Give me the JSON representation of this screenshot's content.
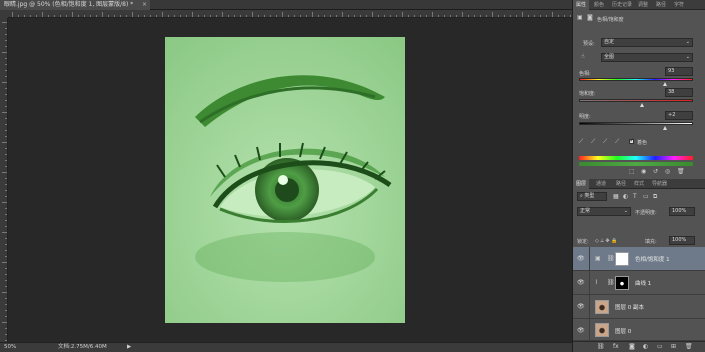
{
  "document": {
    "tab_title": "眼睛.jpg @ 50% (色相/饱和度 1, 图层蒙版/8) *",
    "close_glyph": "×"
  },
  "status": {
    "zoom": "50%",
    "doc_size": "文档:2.75M/6.40M",
    "arrow": "▶"
  },
  "properties_panel": {
    "tabs": [
      "属性",
      "颜色",
      "历史记录",
      "调整",
      "路径",
      "字符"
    ],
    "header": "色相/饱和度",
    "preset_label": "预设:",
    "preset_value": "自定",
    "channel_value": "全图",
    "hue_label": "色相:",
    "hue_value": "93",
    "saturation_label": "饱和度:",
    "saturation_value": "38",
    "lightness_label": "明度:",
    "lightness_value": "+2",
    "colorize_label": "着色",
    "colorize_checked": true,
    "hue_level": 0.75,
    "saturation_level": 0.55,
    "lightness_level": 0.75
  },
  "layers_panel": {
    "tabs": [
      "图层",
      "通道",
      "路径",
      "样式",
      "导航器"
    ],
    "kind_label": "类型",
    "blend_mode": "正常",
    "opacity_label": "不透明度:",
    "opacity_value": "100%",
    "lock_label": "锁定:",
    "fill_label": "填充:",
    "fill_value": "100%",
    "lock_icons": "◇ ⟂ ✥ 🔒",
    "layers": [
      {
        "name": "色相/饱和度 1",
        "selected": true
      },
      {
        "name": "曲线 1",
        "selected": false
      },
      {
        "name": "图层 0 副本",
        "selected": false
      },
      {
        "name": "图层 0",
        "selected": false
      }
    ]
  },
  "colors": {
    "accent": "#6e7a8a",
    "photo_green": "#a7d9a0",
    "eye_green": "#3f8a35"
  }
}
